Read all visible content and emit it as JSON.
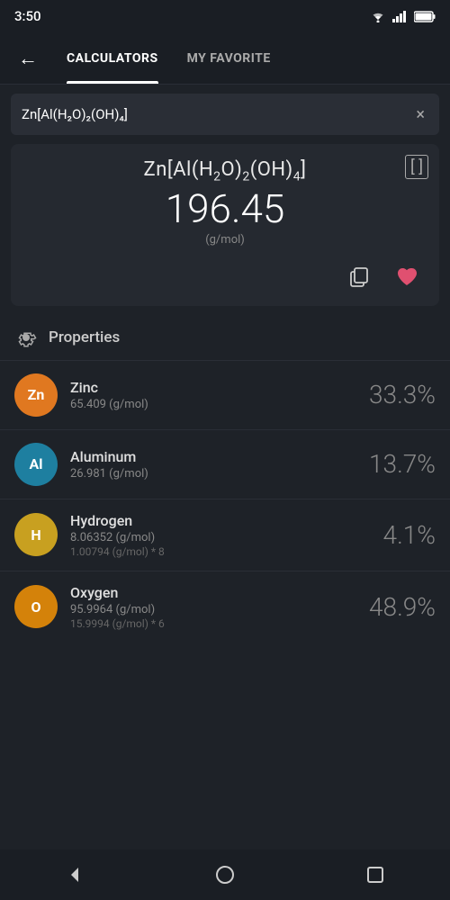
{
  "statusBar": {
    "time": "3:50"
  },
  "nav": {
    "backLabel": "←",
    "tabs": [
      {
        "id": "calculators",
        "label": "CALCULATORS",
        "active": true
      },
      {
        "id": "my-favorite",
        "label": "MY FAVORITE",
        "active": false
      }
    ]
  },
  "searchBar": {
    "value": "Zn[Al(H₂O)₂(OH)₄]",
    "clearLabel": "×"
  },
  "formulaCard": {
    "formula": "Zn[Al(H₂O)₂(OH)₄]",
    "molarMass": "196.45",
    "unit": "(g/mol)",
    "bracketLabel": "[ ]"
  },
  "actions": {
    "copyLabel": "copy",
    "favoriteLabel": "favorite"
  },
  "propertiesSection": {
    "title": "Properties"
  },
  "elements": [
    {
      "symbol": "Zn",
      "name": "Zinc",
      "mass": "65.409 (g/mol)",
      "detail": "",
      "percent": "33.3%",
      "color": "#e07820"
    },
    {
      "symbol": "Al",
      "name": "Aluminum",
      "mass": "26.981 (g/mol)",
      "detail": "",
      "percent": "13.7%",
      "color": "#1e7fa0"
    },
    {
      "symbol": "H",
      "name": "Hydrogen",
      "mass": "8.06352 (g/mol)",
      "detail": "1.00794 (g/mol) * 8",
      "percent": "4.1%",
      "color": "#c8a020"
    },
    {
      "symbol": "O",
      "name": "Oxygen",
      "mass": "95.9964 (g/mol)",
      "detail": "15.9994 (g/mol) * 6",
      "percent": "48.9%",
      "color": "#d4820a"
    }
  ]
}
